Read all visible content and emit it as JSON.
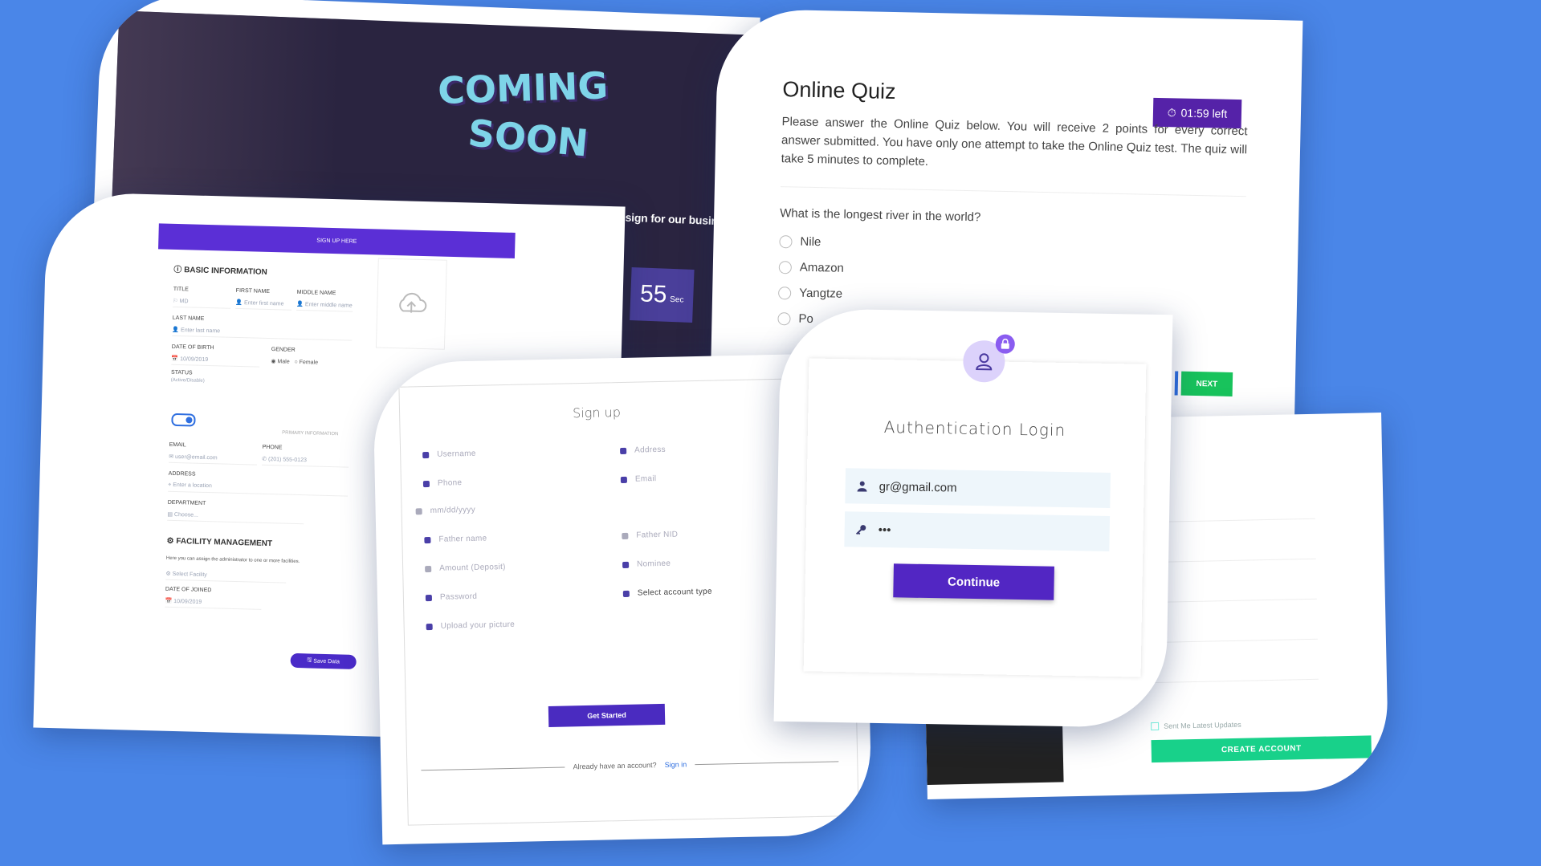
{
  "coming_soon": {
    "logo_line1": "COMING",
    "logo_line2": "SOON",
    "tagline": "We are working on develop new website design for our business.",
    "counter_value": "55",
    "counter_unit": "Sec"
  },
  "quiz": {
    "title": "Online Quiz",
    "timer": "01:59 left",
    "description": "Please answer the Online Quiz below. You will receive 2 points for every correct answer submitted. You have only one attempt to take the Online Quiz test. The quiz will take 5 minutes to complete.",
    "question": "What is the longest river in the world?",
    "options": [
      "Nile",
      "Amazon",
      "Yangtze",
      "Po"
    ],
    "next_label": "NEXT"
  },
  "create_account": {
    "updates_label": "Sent Me Latest Updates",
    "button_label": "CREATE ACCOUNT"
  },
  "basic_form": {
    "header": "SIGN UP HERE",
    "section_basic": "BASIC INFORMATION",
    "title_label": "TITLE",
    "title_value": "MD",
    "first_name_label": "FIRST NAME",
    "first_name_placeholder": "Enter first name",
    "middle_name_label": "MIDDLE NAME",
    "middle_name_placeholder": "Enter middle name",
    "last_name_label": "LAST NAME",
    "last_name_placeholder": "Enter last name",
    "dob_label": "DATE OF BIRTH",
    "dob_value": "10/09/2019",
    "gender_label": "GENDER",
    "gender_male": "Male",
    "gender_female": "Female",
    "status_label": "STATUS",
    "status_sub": "(Active/Disable)",
    "primary_info": "PRIMARY INFORMATION",
    "email_label": "EMAIL",
    "email_placeholder": "user@email.com",
    "phone_label": "PHONE",
    "phone_placeholder": "(201) 555-0123",
    "address_label": "ADDRESS",
    "address_placeholder": "Enter a location",
    "department_label": "DEPARTMENT",
    "department_placeholder": "Choose...",
    "section_facility": "FACILITY MANAGEMENT",
    "facility_desc": "Here you can assign the administrator to one or more facilities.",
    "facility_placeholder": "Select Facility",
    "joined_label": "DATE OF JOINED",
    "joined_value": "10/09/2019",
    "save_label": "Save Data"
  },
  "signup": {
    "title": "Sign up",
    "fields_left": [
      "Username",
      "Phone",
      "mm/dd/yyyy",
      "Father name",
      "Amount (Deposit)",
      "Password",
      "Upload your picture"
    ],
    "fields_right": [
      "Address",
      "Email",
      "Father NID",
      "Nominee",
      "Select account type"
    ],
    "button_label": "Get Started",
    "footer_text": "Already have an account?",
    "footer_link": "Sign in"
  },
  "auth": {
    "title": "Authentication Login",
    "email_value": "gr@gmail.com",
    "password_value": "•••",
    "button_label": "Continue"
  }
}
